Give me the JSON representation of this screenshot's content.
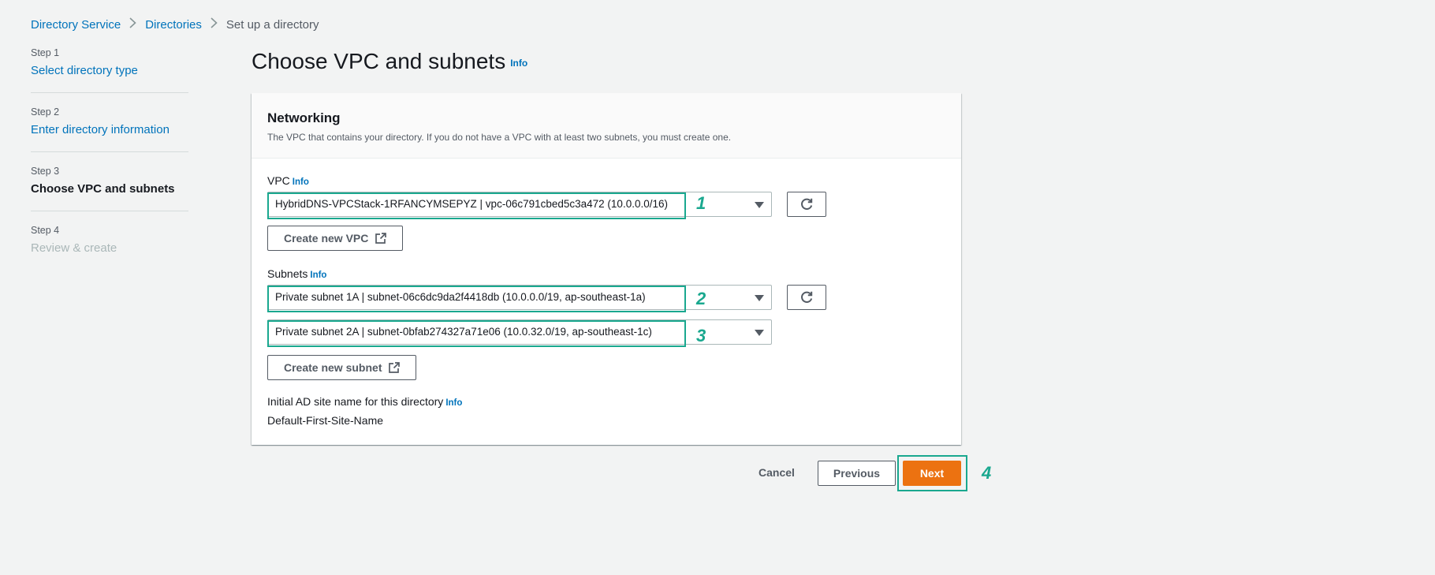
{
  "breadcrumb": {
    "items": [
      "Directory Service",
      "Directories",
      "Set up a directory"
    ]
  },
  "steps": [
    {
      "num": "Step 1",
      "label": "Select directory type",
      "state": "link"
    },
    {
      "num": "Step 2",
      "label": "Enter directory information",
      "state": "link"
    },
    {
      "num": "Step 3",
      "label": "Choose VPC and subnets",
      "state": "active"
    },
    {
      "num": "Step 4",
      "label": "Review & create",
      "state": "disabled"
    }
  ],
  "page": {
    "title": "Choose VPC and subnets",
    "info": "Info"
  },
  "networking": {
    "title": "Networking",
    "description": "The VPC that contains your directory. If you do not have a VPC with at least two subnets, you must create one.",
    "vpc_label": "VPC",
    "vpc_info": "Info",
    "vpc_value": "HybridDNS-VPCStack-1RFANCYMSEPYZ | vpc-06c791cbed5c3a472 (10.0.0.0/16)",
    "create_vpc": "Create new VPC",
    "subnets_label": "Subnets",
    "subnets_info": "Info",
    "subnet1_value": "Private subnet 1A | subnet-06c6dc9da2f4418db (10.0.0.0/19, ap-southeast-1a)",
    "subnet2_value": "Private subnet 2A | subnet-0bfab274327a71e06 (10.0.32.0/19, ap-southeast-1c)",
    "create_subnet": "Create new subnet",
    "site_label": "Initial AD site name for this directory",
    "site_info": "Info",
    "site_value": "Default-First-Site-Name"
  },
  "footer": {
    "cancel": "Cancel",
    "previous": "Previous",
    "next": "Next"
  },
  "annotations": [
    "1",
    "2",
    "3",
    "4"
  ],
  "colors": {
    "accent": "#ec7211",
    "link": "#0073bb",
    "highlight": "#1aa88f",
    "background": "#f2f3f3"
  },
  "icons": {
    "refresh": "refresh-icon",
    "external": "external-link-icon",
    "breadcrumb_sep": "chevron-right-icon",
    "dropdown": "caret-down-icon"
  }
}
